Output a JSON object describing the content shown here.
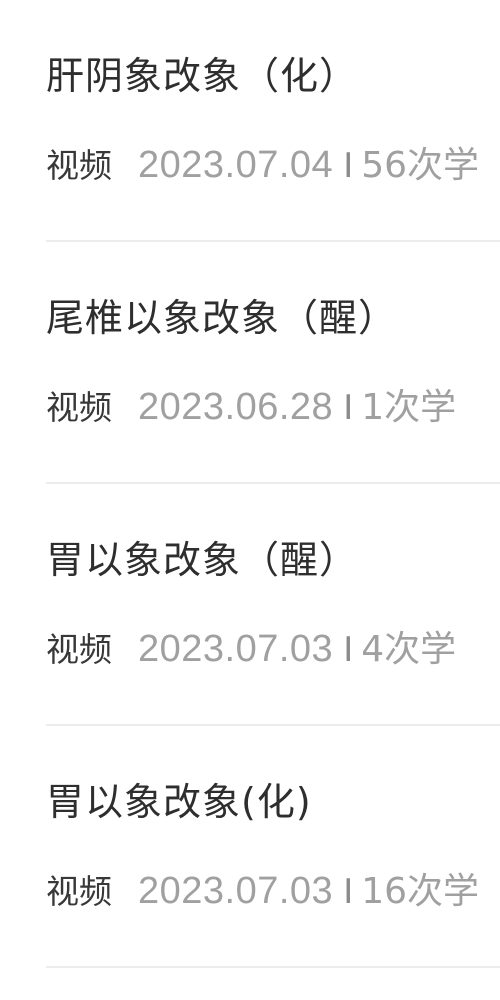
{
  "list": {
    "items": [
      {
        "title": "肝阴象改象（化）",
        "type": "视频",
        "date": "2023.07.04",
        "separator": "I",
        "count": "56次学"
      },
      {
        "title": "尾椎以象改象（醒）",
        "type": "视频",
        "date": "2023.06.28",
        "separator": "I",
        "count": "1次学"
      },
      {
        "title": "胃以象改象（醒）",
        "type": "视频",
        "date": "2023.07.03",
        "separator": "I",
        "count": "4次学"
      },
      {
        "title": "胃以象改象(化)",
        "type": "视频",
        "date": "2023.07.03",
        "separator": "I",
        "count": "16次学"
      }
    ]
  }
}
